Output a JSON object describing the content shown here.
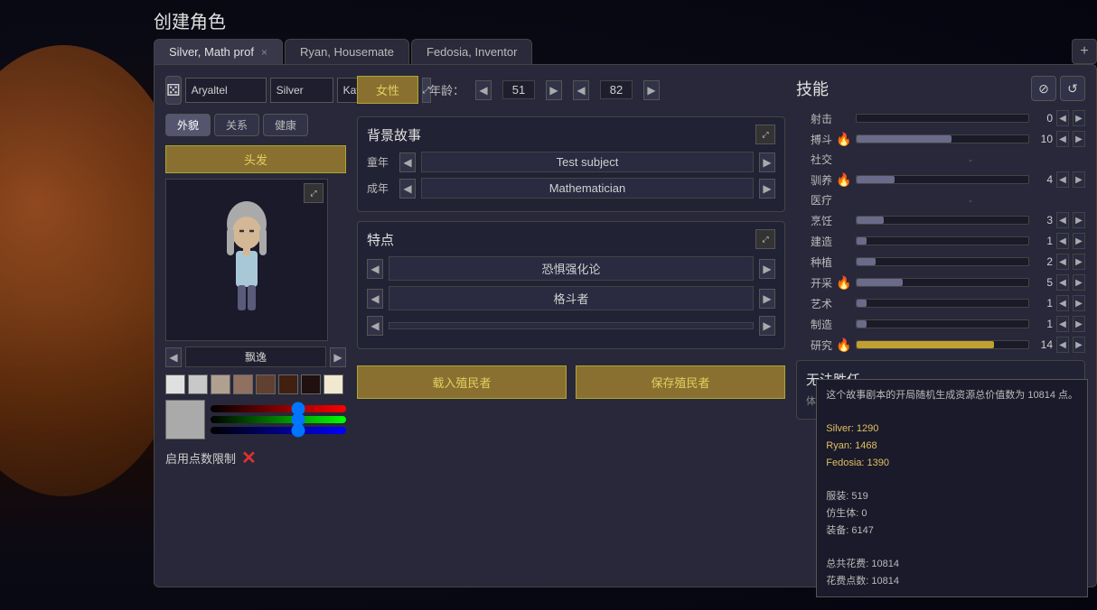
{
  "page": {
    "title": "创建角色"
  },
  "tabs": [
    {
      "id": "silver",
      "label": "Silver, Math prof",
      "active": true,
      "closeable": true
    },
    {
      "id": "ryan",
      "label": "Ryan, Housemate",
      "active": false,
      "closeable": false
    },
    {
      "id": "fedosia",
      "label": "Fedosia, Inventor",
      "active": false,
      "closeable": false
    }
  ],
  "tab_add_label": "+",
  "character": {
    "first_name": "Aryaltel",
    "middle_name": "Silver",
    "last_name": "Kavka",
    "gender": "女性",
    "age_label": "年龄：",
    "age_min": "51",
    "age_max": "82",
    "sub_tabs": [
      {
        "label": "外貌",
        "active": true
      },
      {
        "label": "关系",
        "active": false
      },
      {
        "label": "健康",
        "active": false
      }
    ],
    "hair_btn": "头发",
    "style_label": "飘逸",
    "color_swatches": [
      "#e0e0e0",
      "#c8c8c8",
      "#b0a090",
      "#907060",
      "#604030",
      "#402010",
      "#201010",
      "#f0e8d0"
    ],
    "backstory": {
      "title": "背景故事",
      "childhood_label": "童年",
      "childhood_value": "Test subject",
      "adult_label": "成年",
      "adult_value": "Mathematician"
    },
    "traits": {
      "title": "特点",
      "trait1": "恐惧强化论",
      "trait2": "格斗者",
      "trait3": ""
    },
    "load_btn": "载入殖民者",
    "save_btn": "保存殖民者",
    "point_limit_label": "启用点数限制"
  },
  "skills": {
    "title": "技能",
    "reset_icon": "⊘",
    "refresh_icon": "↺",
    "items": [
      {
        "name": "射击",
        "fire": false,
        "value": "0",
        "bar": 0
      },
      {
        "name": "搏斗",
        "fire": true,
        "value": "10",
        "bar": 55
      },
      {
        "name": "社交",
        "fire": false,
        "value": "-",
        "bar": 0,
        "dash": true
      },
      {
        "name": "驯养",
        "fire": true,
        "value": "4",
        "bar": 22
      },
      {
        "name": "医疗",
        "fire": false,
        "value": "-",
        "bar": 0,
        "dash": true
      },
      {
        "name": "烹饪",
        "fire": false,
        "value": "3",
        "bar": 16
      },
      {
        "name": "建造",
        "fire": false,
        "value": "1",
        "bar": 6
      },
      {
        "name": "种植",
        "fire": false,
        "value": "2",
        "bar": 11
      },
      {
        "name": "开采",
        "fire": true,
        "value": "5",
        "bar": 27
      },
      {
        "name": "艺术",
        "fire": false,
        "value": "1",
        "bar": 6
      },
      {
        "name": "制造",
        "fire": false,
        "value": "1",
        "bar": 6
      },
      {
        "name": "研究",
        "fire": true,
        "value": "14",
        "bar": 80,
        "gold": true
      }
    ]
  },
  "no_task": {
    "title": "无法胜任",
    "desc": "体力工作, 照料他人, 进行社交, 恐惧强化论, 灭火行为"
  },
  "tooltip": {
    "desc": "这个故事剧本的开局随机生成资源总价值数为 10814 点。",
    "silver": "Silver: 1290",
    "ryan": "Ryan: 1468",
    "fedosia": "Fedosia: 1390",
    "clothes": "服装: 519",
    "bionic": "仿生体: 0",
    "equip": "装备: 6147",
    "total": "总共花费: 10814",
    "points": "花费点数: 10814"
  },
  "fire_emoji": "🔥"
}
